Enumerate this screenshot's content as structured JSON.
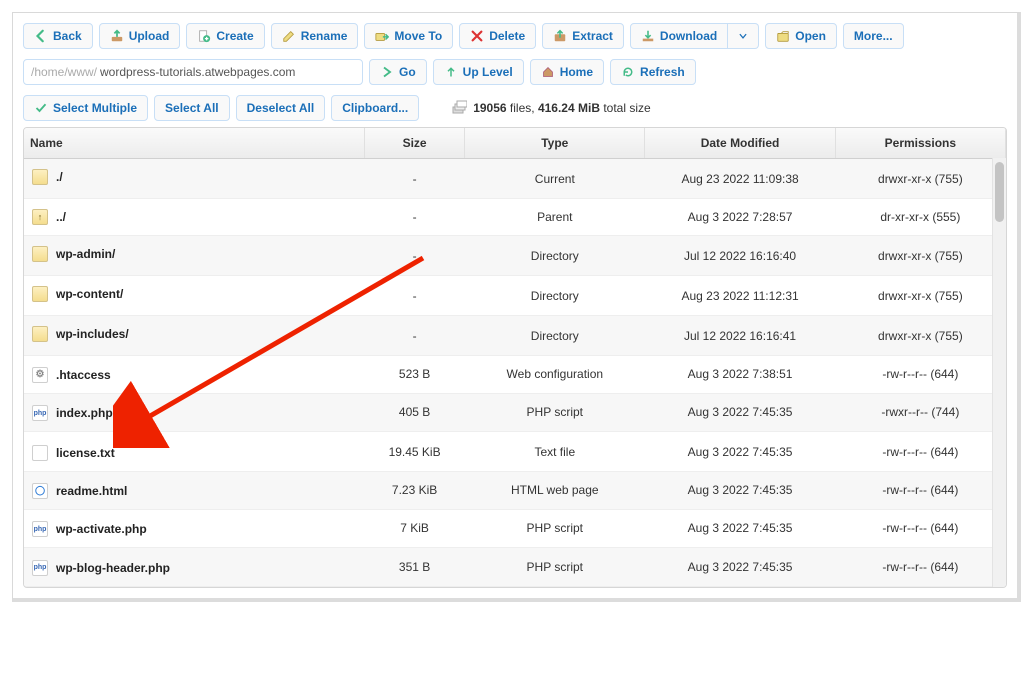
{
  "toolbar": {
    "back": "Back",
    "upload": "Upload",
    "create": "Create",
    "rename": "Rename",
    "move_to": "Move To",
    "delete": "Delete",
    "extract": "Extract",
    "download": "Download",
    "open": "Open",
    "more": "More..."
  },
  "path": {
    "prefix": "/home/www/",
    "value": "wordpress-tutorials.atwebpages.com"
  },
  "nav": {
    "go": "Go",
    "up_level": "Up Level",
    "home": "Home",
    "refresh": "Refresh"
  },
  "selection": {
    "select_multiple": "Select Multiple",
    "select_all": "Select All",
    "deselect_all": "Deselect All",
    "clipboard": "Clipboard..."
  },
  "stats": {
    "file_count": "19056",
    "files_word": "files,",
    "total_size": "416.24 MiB",
    "suffix": "total size"
  },
  "columns": {
    "name": "Name",
    "size": "Size",
    "type": "Type",
    "date": "Date Modified",
    "perm": "Permissions"
  },
  "rows": [
    {
      "icon": "folder",
      "name": "./",
      "size": "-",
      "type": "Current",
      "date": "Aug 23 2022 11:09:38",
      "perm": "drwxr-xr-x (755)"
    },
    {
      "icon": "folder-up",
      "name": "../",
      "size": "-",
      "type": "Parent",
      "date": "Aug 3 2022 7:28:57",
      "perm": "dr-xr-xr-x (555)"
    },
    {
      "icon": "folder",
      "name": "wp-admin/",
      "size": "-",
      "type": "Directory",
      "date": "Jul 12 2022 16:16:40",
      "perm": "drwxr-xr-x (755)"
    },
    {
      "icon": "folder",
      "name": "wp-content/",
      "size": "-",
      "type": "Directory",
      "date": "Aug 23 2022 11:12:31",
      "perm": "drwxr-xr-x (755)"
    },
    {
      "icon": "folder",
      "name": "wp-includes/",
      "size": "-",
      "type": "Directory",
      "date": "Jul 12 2022 16:16:41",
      "perm": "drwxr-xr-x (755)"
    },
    {
      "icon": "cfg",
      "name": ".htaccess",
      "size": "523 B",
      "type": "Web configuration",
      "date": "Aug 3 2022 7:38:51",
      "perm": "-rw-r--r-- (644)"
    },
    {
      "icon": "php",
      "name": "index.php",
      "star": "*",
      "size": "405 B",
      "type": "PHP script",
      "date": "Aug 3 2022 7:45:35",
      "perm": "-rwxr--r-- (744)"
    },
    {
      "icon": "txt",
      "name": "license.txt",
      "size": "19.45 KiB",
      "type": "Text file",
      "date": "Aug 3 2022 7:45:35",
      "perm": "-rw-r--r-- (644)"
    },
    {
      "icon": "html",
      "name": "readme.html",
      "size": "7.23 KiB",
      "type": "HTML web page",
      "date": "Aug 3 2022 7:45:35",
      "perm": "-rw-r--r-- (644)"
    },
    {
      "icon": "php",
      "name": "wp-activate.php",
      "size": "7 KiB",
      "type": "PHP script",
      "date": "Aug 3 2022 7:45:35",
      "perm": "-rw-r--r-- (644)"
    },
    {
      "icon": "php",
      "name": "wp-blog-header.php",
      "size": "351 B",
      "type": "PHP script",
      "date": "Aug 3 2022 7:45:35",
      "perm": "-rw-r--r-- (644)"
    }
  ]
}
